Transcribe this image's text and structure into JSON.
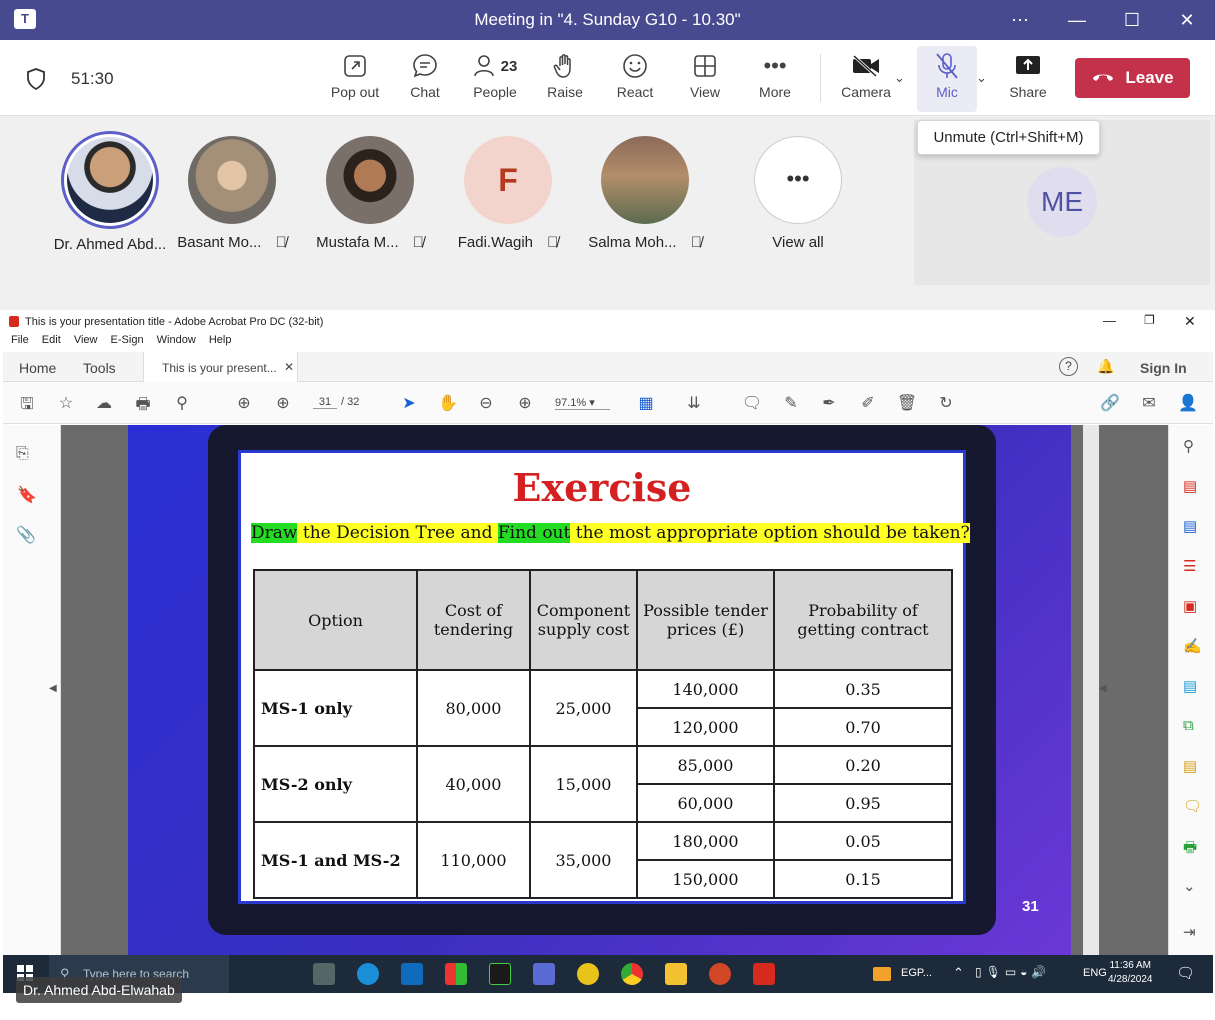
{
  "window": {
    "title": "Meeting in \"4. Sunday G10 - 10.30\""
  },
  "meeting": {
    "timer": "51:30",
    "people_count": "23",
    "toolbar": {
      "popout": "Pop out",
      "chat": "Chat",
      "people": "People",
      "raise": "Raise",
      "react": "React",
      "view": "View",
      "more": "More",
      "camera": "Camera",
      "mic": "Mic",
      "share": "Share",
      "leave": "Leave"
    },
    "tooltip": "Unmute (Ctrl+Shift+M)",
    "participants": [
      {
        "name": "Dr. Ahmed Abd...",
        "muted": false
      },
      {
        "name": "Basant Mo...",
        "muted": true
      },
      {
        "name": "Mustafa M...",
        "muted": true
      },
      {
        "name": "Fadi.Wagih",
        "initial": "F",
        "muted": true
      },
      {
        "name": "Salma Moh...",
        "muted": true
      },
      {
        "name": "View all"
      }
    ],
    "self_initials": "ME",
    "presenter_tag": "Dr. Ahmed Abd-Elwahab"
  },
  "acrobat": {
    "title": "This is your presentation title - Adobe Acrobat Pro DC (32-bit)",
    "menu": [
      "File",
      "Edit",
      "View",
      "E-Sign",
      "Window",
      "Help"
    ],
    "tabs": {
      "home": "Home",
      "tools": "Tools",
      "doc": "This is your present..."
    },
    "sign_in": "Sign In",
    "page_current": "31",
    "page_total": "/ 32",
    "zoom": "97.1%"
  },
  "slide": {
    "title": "Exercise",
    "instruction": {
      "w1": "Draw",
      "w2": " the Decision Tree and ",
      "w3": "Find out",
      "w4": " the most appropriate option should be taken?"
    },
    "headers": [
      "Option",
      "Cost of tendering",
      "Component supply cost",
      "Possible tender prices (£)",
      "Probability of getting contract"
    ],
    "rows": [
      {
        "option": "MS-1 only",
        "cost": "80,000",
        "supply": "25,000",
        "prices": [
          "140,000",
          "120,000"
        ],
        "probs": [
          "0.35",
          "0.70"
        ]
      },
      {
        "option": "MS-2 only",
        "cost": "40,000",
        "supply": "15,000",
        "prices": [
          "85,000",
          "60,000"
        ],
        "probs": [
          "0.20",
          "0.95"
        ]
      },
      {
        "option": "MS-1 and MS-2",
        "cost": "110,000",
        "supply": "35,000",
        "prices": [
          "180,000",
          "150,000"
        ],
        "probs": [
          "0.05",
          "0.15"
        ]
      }
    ],
    "page_number": "31"
  },
  "taskbar": {
    "search_placeholder": "Type here to search",
    "lang": "ENG",
    "currency": "EGP...",
    "time": "11:36 AM",
    "date": "4/28/2024"
  },
  "colors": {
    "teams_purple": "#484a8f",
    "leave_red": "#c4314b",
    "mic_accent": "#5b5fc7"
  }
}
